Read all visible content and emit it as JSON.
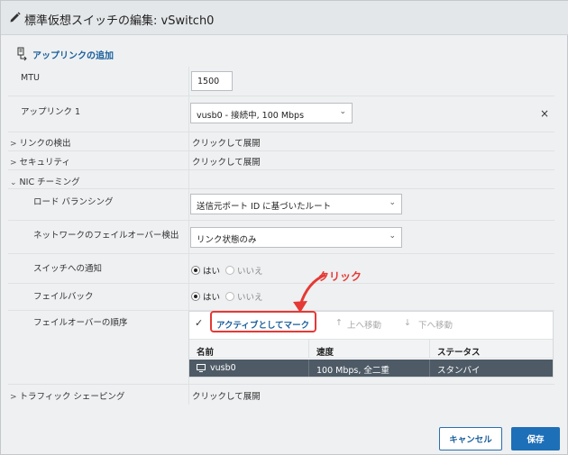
{
  "window": {
    "title": "標準仮想スイッチの編集: vSwitch0"
  },
  "uplink_add": {
    "label": "アップリンクの追加",
    "icon": "add-uplink-icon"
  },
  "mtu": {
    "label": "MTU",
    "value": "1500"
  },
  "uplink1": {
    "label": "アップリンク 1",
    "value": "vusb0 - 接続中, 100 Mbps"
  },
  "link_discovery": {
    "label": "リンクの検出",
    "value": "クリックして展開"
  },
  "security": {
    "label": "セキュリティ",
    "value": "クリックして展開"
  },
  "nic_teaming": {
    "label": "NIC チーミング"
  },
  "load_balancing": {
    "label": "ロード バランシング",
    "value": "送信元ポート ID に基づいたルート"
  },
  "failover_detection": {
    "label": "ネットワークのフェイルオーバー検出",
    "value": "リンク状態のみ"
  },
  "notify_switches": {
    "label": "スイッチへの通知",
    "yes": "はい",
    "no": "いいえ",
    "selected": "yes"
  },
  "failback": {
    "label": "フェイルバック",
    "yes": "はい",
    "no": "いいえ",
    "selected": "yes"
  },
  "failover_order": {
    "label": "フェイルオーバーの順序",
    "toolbar": {
      "mark_active": "アクティブとしてマーク",
      "move_up": "上へ移動",
      "move_down": "下へ移動"
    },
    "columns": [
      "名前",
      "速度",
      "ステータス"
    ],
    "rows": [
      {
        "name": "vusb0",
        "speed": "100 Mbps, 全二重",
        "status": "スタンバイ"
      }
    ]
  },
  "traffic_shaping": {
    "label": "トラフィック シェーピング",
    "value": "クリックして展開"
  },
  "annotation": {
    "text": "クリック",
    "color": "#e53935"
  },
  "footer": {
    "cancel": "キャンセル",
    "save": "保存"
  },
  "colors": {
    "accent": "#1d6fb8",
    "selected_row": "#4e5b66",
    "annotation": "#e53935"
  }
}
